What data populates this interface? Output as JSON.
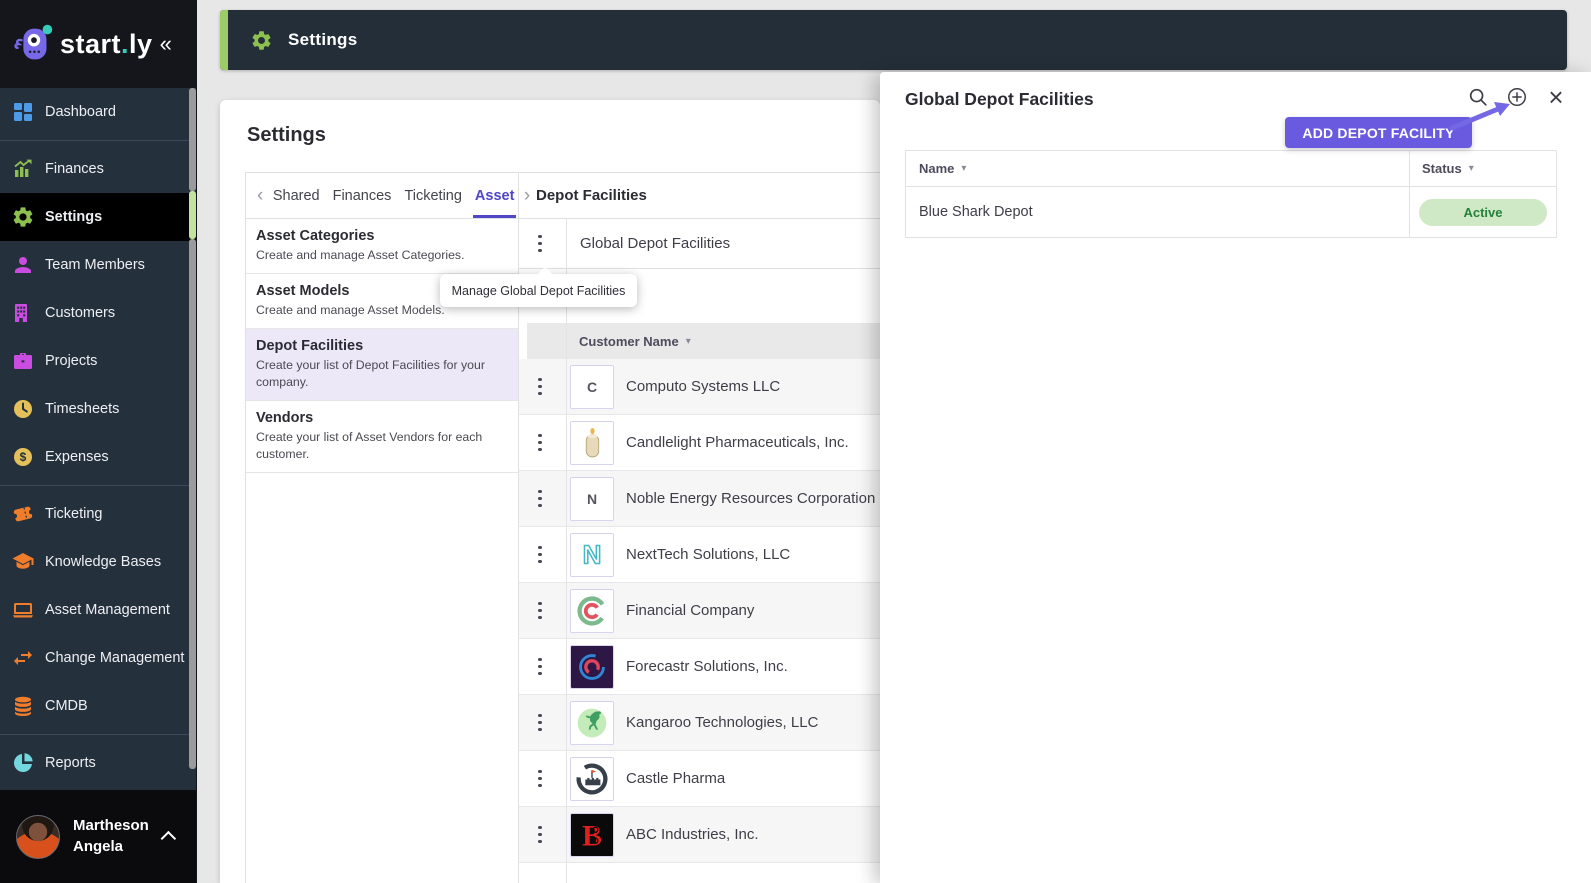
{
  "colors": {
    "accent_green": "#9ccc65",
    "accent_purple": "#6a5ae0",
    "tab_active_purple": "#4f46c8",
    "sidebar_bg": "#25303d",
    "topbar_bg": "#232e38",
    "selected_category_bg": "#ece8f8",
    "active_badge_bg": "#cfe9c6",
    "active_badge_text": "#26813b"
  },
  "ui": {
    "sort_caret": "▾",
    "close_glyph": "×",
    "tabs_prev": "‹",
    "tabs_next": "›"
  },
  "brand": {
    "name": "start.ly",
    "collapse": "«"
  },
  "topbar": {
    "title": "Settings"
  },
  "sidebar": {
    "items": [
      {
        "label": "Dashboard",
        "icon": "dashboard",
        "color": "#4d9be8",
        "divider_after": true
      },
      {
        "label": "Finances",
        "icon": "finances",
        "color": "#8dc04f"
      },
      {
        "label": "Settings",
        "icon": "gear",
        "color": "#8dc04f",
        "active": true
      },
      {
        "label": "Team Members",
        "icon": "person",
        "color": "#cb4ce0"
      },
      {
        "label": "Customers",
        "icon": "building",
        "color": "#cb4ce0"
      },
      {
        "label": "Projects",
        "icon": "briefcase",
        "color": "#cb4ce0"
      },
      {
        "label": "Timesheets",
        "icon": "clock",
        "color": "#e5c05a"
      },
      {
        "label": "Expenses",
        "icon": "dollar",
        "color": "#e5c05a",
        "divider_after": true
      },
      {
        "label": "Ticketing",
        "icon": "ticket",
        "color": "#ef7d2c"
      },
      {
        "label": "Knowledge Bases",
        "icon": "graduation-cap",
        "color": "#ef7d2c"
      },
      {
        "label": "Asset Management",
        "icon": "laptop",
        "color": "#ef7d2c"
      },
      {
        "label": "Change Management",
        "icon": "swap-arrows",
        "color": "#ef7d2c"
      },
      {
        "label": "CMDB",
        "icon": "database",
        "color": "#ef7d2c",
        "divider_after": true
      },
      {
        "label": "Reports",
        "icon": "pie-chart",
        "color": "#74d7de"
      }
    ],
    "user": {
      "first": "Martheson",
      "last": "Angela"
    }
  },
  "settings": {
    "page_title": "Settings",
    "tabs": [
      {
        "label": "Shared"
      },
      {
        "label": "Finances"
      },
      {
        "label": "Ticketing"
      },
      {
        "label": "Asset",
        "active": true
      }
    ],
    "section_title": "Depot Facilities",
    "categories": [
      {
        "title": "Asset Categories",
        "desc": "Create and manage Asset Categories.",
        "selected": false
      },
      {
        "title": "Asset Models",
        "desc": "Create and manage Asset Models.",
        "selected": false
      },
      {
        "title": "Depot Facilities",
        "desc": "Create your list of Depot Facilities for your company.",
        "selected": true
      },
      {
        "title": "Vendors",
        "desc": "Create your list of Asset Vendors for each customer.",
        "selected": false
      }
    ],
    "global_row": "Global Depot Facilities",
    "tooltip": "Manage Global Depot Facilities",
    "customers": {
      "header": "Customer Name",
      "rows": [
        {
          "name": "Computo Systems LLC",
          "logo": "letter-c"
        },
        {
          "name": "Candlelight Pharmaceuticals, Inc.",
          "logo": "candle"
        },
        {
          "name": "Noble Energy Resources Corporation",
          "logo": "letter-n"
        },
        {
          "name": "NextTech Solutions, LLC",
          "logo": "nexttech-n"
        },
        {
          "name": "Financial Company",
          "logo": "concentric-c"
        },
        {
          "name": "Forecastr Solutions, Inc.",
          "logo": "swirl"
        },
        {
          "name": "Kangaroo Technologies, LLC",
          "logo": "kangaroo"
        },
        {
          "name": "Castle Pharma",
          "logo": "castle"
        },
        {
          "name": "ABC Industries, Inc.",
          "logo": "circuit-b"
        }
      ]
    }
  },
  "depot_panel": {
    "title": "Global Depot Facilities",
    "callout": "ADD DEPOT FACILITY",
    "table": {
      "name_col": "Name",
      "status_col": "Status",
      "rows": [
        {
          "name": "Blue Shark Depot",
          "status": "Active"
        }
      ]
    }
  }
}
